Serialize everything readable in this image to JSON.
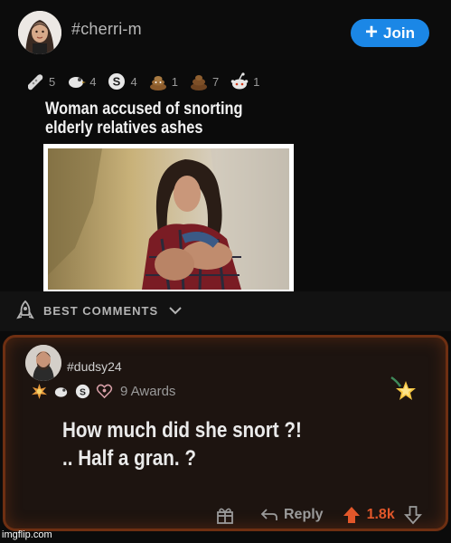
{
  "post": {
    "author": "#cherri-m",
    "join_label": "Join",
    "awards": [
      {
        "icon": "bandaid-award-icon",
        "count": "5"
      },
      {
        "icon": "bird-award-icon",
        "count": "4"
      },
      {
        "icon": "silver-award-icon",
        "count": "4"
      },
      {
        "icon": "poop-award-icon",
        "count": "1"
      },
      {
        "icon": "poop-pile-award-icon",
        "count": "7"
      },
      {
        "icon": "snoo-award-icon",
        "count": "1"
      }
    ],
    "headline": "Woman accused of snorting elderly relatives ashes"
  },
  "best_comments_label": "BEST COMMENTS",
  "comment": {
    "author": "#dudsy24",
    "awards_label": "9 Awards",
    "text": "How much did she snort ?! .. Half a gran. ?",
    "reply_label": "Reply",
    "score": "1.8k"
  },
  "watermark": "imgflip.com",
  "colors": {
    "join_button": "#1b87e6",
    "upvote": "#e2572a",
    "comment_border": "#6e2f12"
  }
}
